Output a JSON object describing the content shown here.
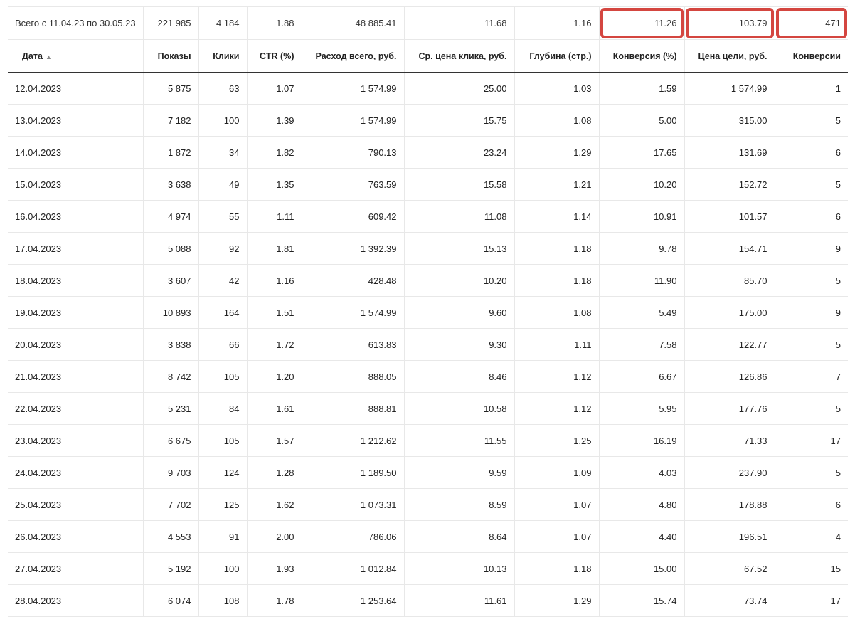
{
  "table": {
    "total": {
      "label": "Всего с 11.04.23 по 30.05.23",
      "values": [
        "221 985",
        "4 184",
        "1.88",
        "48 885.41",
        "11.68",
        "1.16",
        "11.26",
        "103.79",
        "471"
      ],
      "highlight_color": "#d44640",
      "highlighted_columns": [
        "Конверсия (%)",
        "Цена цели, руб.",
        "Конверсии"
      ]
    },
    "headers": [
      "Дата",
      "Показы",
      "Клики",
      "CTR (%)",
      "Расход всего, руб.",
      "Ср. цена клика, руб.",
      "Глубина (стр.)",
      "Конверсия (%)",
      "Цена цели, руб.",
      "Конверсии"
    ],
    "sort_indicator": "▲",
    "rows": [
      [
        "12.04.2023",
        "5 875",
        "63",
        "1.07",
        "1 574.99",
        "25.00",
        "1.03",
        "1.59",
        "1 574.99",
        "1"
      ],
      [
        "13.04.2023",
        "7 182",
        "100",
        "1.39",
        "1 574.99",
        "15.75",
        "1.08",
        "5.00",
        "315.00",
        "5"
      ],
      [
        "14.04.2023",
        "1 872",
        "34",
        "1.82",
        "790.13",
        "23.24",
        "1.29",
        "17.65",
        "131.69",
        "6"
      ],
      [
        "15.04.2023",
        "3 638",
        "49",
        "1.35",
        "763.59",
        "15.58",
        "1.21",
        "10.20",
        "152.72",
        "5"
      ],
      [
        "16.04.2023",
        "4 974",
        "55",
        "1.11",
        "609.42",
        "11.08",
        "1.14",
        "10.91",
        "101.57",
        "6"
      ],
      [
        "17.04.2023",
        "5 088",
        "92",
        "1.81",
        "1 392.39",
        "15.13",
        "1.18",
        "9.78",
        "154.71",
        "9"
      ],
      [
        "18.04.2023",
        "3 607",
        "42",
        "1.16",
        "428.48",
        "10.20",
        "1.18",
        "11.90",
        "85.70",
        "5"
      ],
      [
        "19.04.2023",
        "10 893",
        "164",
        "1.51",
        "1 574.99",
        "9.60",
        "1.08",
        "5.49",
        "175.00",
        "9"
      ],
      [
        "20.04.2023",
        "3 838",
        "66",
        "1.72",
        "613.83",
        "9.30",
        "1.11",
        "7.58",
        "122.77",
        "5"
      ],
      [
        "21.04.2023",
        "8 742",
        "105",
        "1.20",
        "888.05",
        "8.46",
        "1.12",
        "6.67",
        "126.86",
        "7"
      ],
      [
        "22.04.2023",
        "5 231",
        "84",
        "1.61",
        "888.81",
        "10.58",
        "1.12",
        "5.95",
        "177.76",
        "5"
      ],
      [
        "23.04.2023",
        "6 675",
        "105",
        "1.57",
        "1 212.62",
        "11.55",
        "1.25",
        "16.19",
        "71.33",
        "17"
      ],
      [
        "24.04.2023",
        "9 703",
        "124",
        "1.28",
        "1 189.50",
        "9.59",
        "1.09",
        "4.03",
        "237.90",
        "5"
      ],
      [
        "25.04.2023",
        "7 702",
        "125",
        "1.62",
        "1 073.31",
        "8.59",
        "1.07",
        "4.80",
        "178.88",
        "6"
      ],
      [
        "26.04.2023",
        "4 553",
        "91",
        "2.00",
        "786.06",
        "8.64",
        "1.07",
        "4.40",
        "196.51",
        "4"
      ],
      [
        "27.04.2023",
        "5 192",
        "100",
        "1.93",
        "1 012.84",
        "10.13",
        "1.18",
        "15.00",
        "67.52",
        "15"
      ],
      [
        "28.04.2023",
        "6 074",
        "108",
        "1.78",
        "1 253.64",
        "11.61",
        "1.29",
        "15.74",
        "73.74",
        "17"
      ]
    ]
  }
}
